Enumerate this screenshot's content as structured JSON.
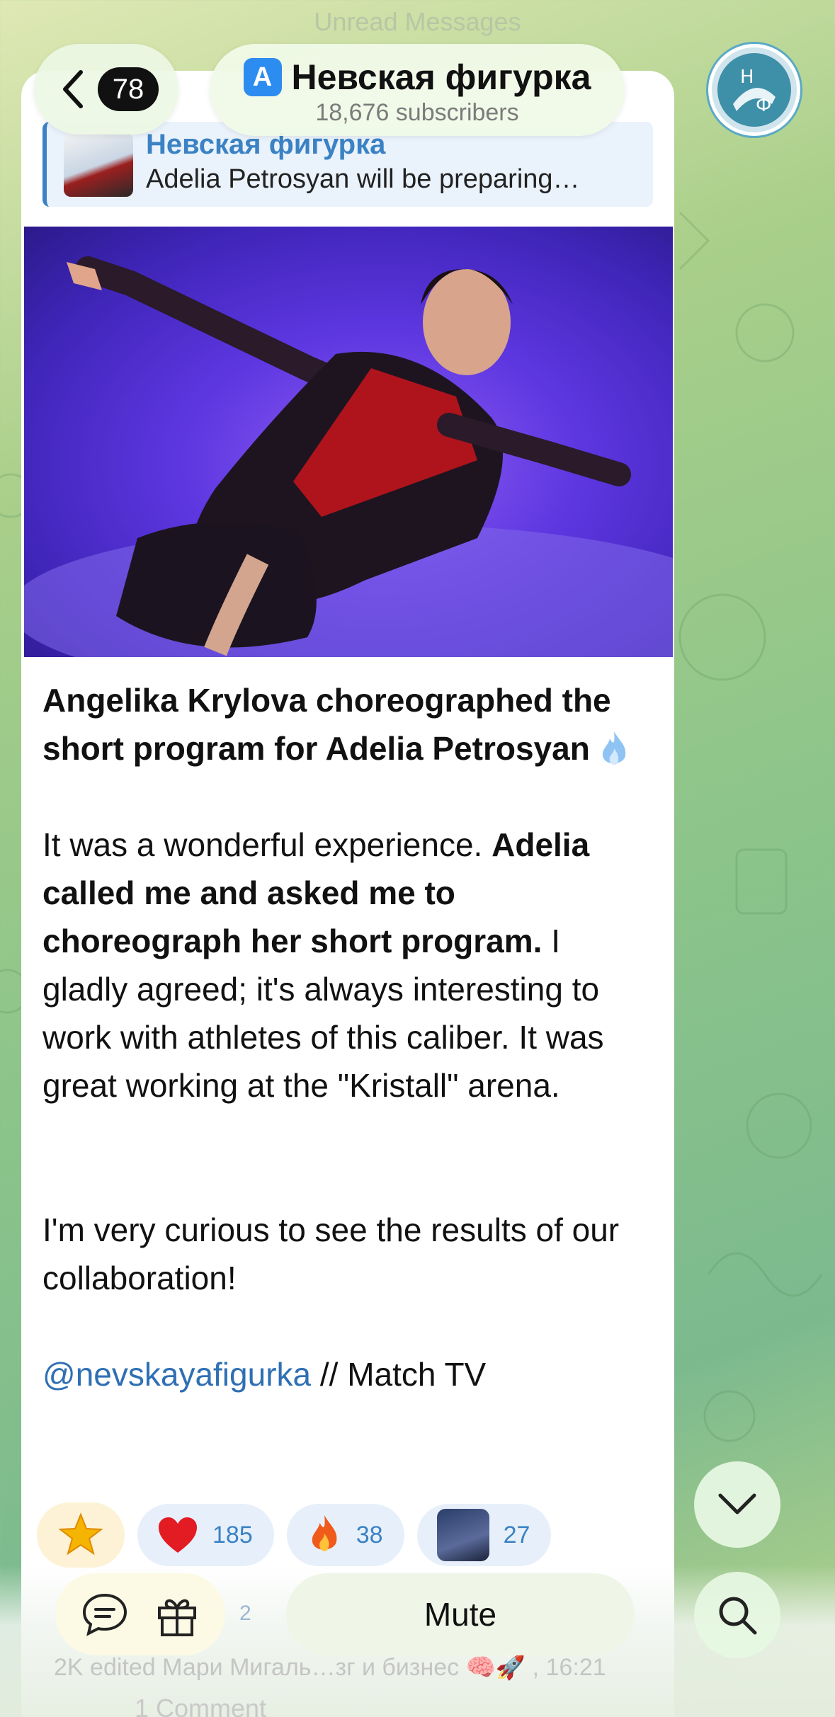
{
  "header": {
    "back_count": "78",
    "channel_name": "Невская фигурка",
    "subscribers": "18,676 subscribers",
    "background_title": "Unread Messages"
  },
  "reply": {
    "title": "Невская фигурка",
    "text": "Adelia Petrosyan will be preparing…"
  },
  "message": {
    "headline": "Angelika Krylova choreographed the short program for Adelia Petrosyan",
    "p1_normal_a": "It was a wonderful experience.",
    "p1_bold": "Adelia called me and asked me to choreograph her short program.",
    "p1_normal_b": "I gladly agreed; it's always interesting to work with athletes of this caliber. It was great working at the \"Kristall\" arena.",
    "p2": "I'm very curious to see the results of our collaboration!",
    "link": "@nevskayafigurka",
    "source": "// Match TV"
  },
  "reactions": [
    {
      "icon": "heart-icon",
      "count": "185"
    },
    {
      "icon": "fire-icon",
      "count": "38"
    },
    {
      "icon": "photo-reaction",
      "count": "27"
    }
  ],
  "footer": {
    "stats_ghost": "2K edited Мари Мигаль…зг и бизнес 🧠🚀 , 16:21",
    "comments_ghost": "1 Comment",
    "hidden_count": "2",
    "mute_label": "Mute"
  },
  "colors": {
    "accent": "#3b82c4",
    "link": "#2f6fb4",
    "badge_bg": "#111111"
  }
}
